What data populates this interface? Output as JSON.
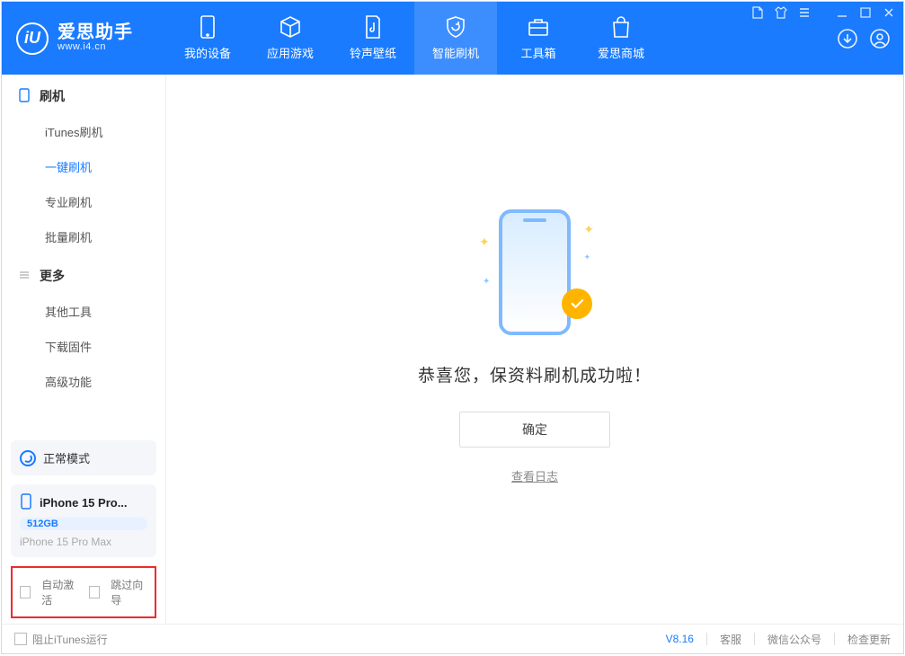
{
  "app": {
    "name": "爱思助手",
    "url": "www.i4.cn"
  },
  "nav": {
    "items": [
      {
        "label": "我的设备"
      },
      {
        "label": "应用游戏"
      },
      {
        "label": "铃声壁纸"
      },
      {
        "label": "智能刷机"
      },
      {
        "label": "工具箱"
      },
      {
        "label": "爱思商城"
      }
    ],
    "active_index": 3
  },
  "sidebar": {
    "group1": {
      "title": "刷机",
      "items": [
        "iTunes刷机",
        "一键刷机",
        "专业刷机",
        "批量刷机"
      ],
      "active_index": 1
    },
    "group2": {
      "title": "更多",
      "items": [
        "其他工具",
        "下载固件",
        "高级功能"
      ]
    },
    "mode_label": "正常模式",
    "device": {
      "name": "iPhone 15 Pro...",
      "storage": "512GB",
      "full": "iPhone 15 Pro Max"
    },
    "checks": {
      "auto_activate": "自动激活",
      "skip_guide": "跳过向导"
    }
  },
  "main": {
    "message": "恭喜您，保资料刷机成功啦！",
    "ok": "确定",
    "log": "查看日志"
  },
  "footer": {
    "block_itunes": "阻止iTunes运行",
    "version": "V8.16",
    "links": [
      "客服",
      "微信公众号",
      "检查更新"
    ]
  }
}
